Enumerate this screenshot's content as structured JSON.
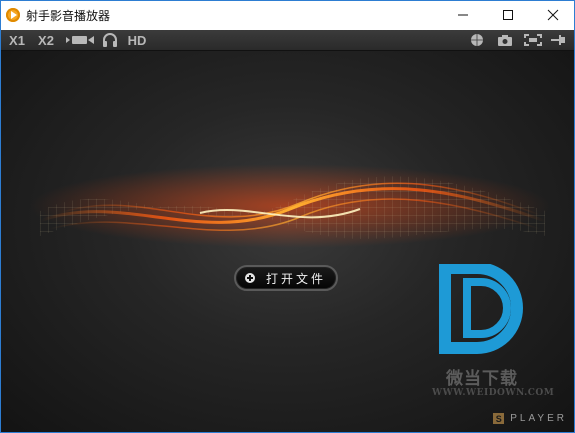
{
  "window": {
    "title": "射手影音播放器",
    "controls": {
      "minimize": "minimize",
      "maximize": "maximize",
      "close": "close"
    }
  },
  "toolbar": {
    "speed_1x": "X1",
    "speed_2x": "X2",
    "hd_label": "HD",
    "left_icons": [
      "video-mode-icon",
      "headphones-icon"
    ],
    "right_icons": [
      "globe-icon",
      "camera-icon",
      "fullscreen-icon",
      "pin-icon"
    ]
  },
  "main": {
    "open_file_label": "打开文件"
  },
  "watermark": {
    "cn_text": "微当下载",
    "url_text": "WWW.WEIDOWN.COM"
  },
  "branding": {
    "mark": "S",
    "player_text": "PLAYER"
  },
  "colors": {
    "accent": "#2d7dd2",
    "watermark_logo": "#1e9ad6",
    "wave_orange": "#ff7a1a"
  }
}
